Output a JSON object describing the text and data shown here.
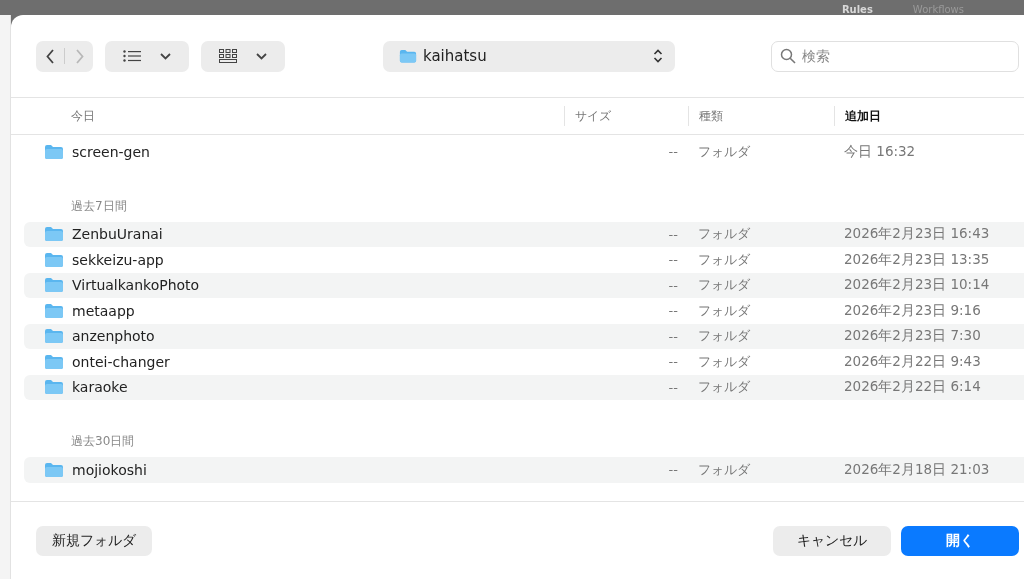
{
  "background_tabs": [
    {
      "label": "Rules",
      "selected": true
    },
    {
      "label": "Workflows",
      "selected": false
    }
  ],
  "toolbar": {
    "back_disabled": false,
    "forward_disabled": true,
    "location": "kaihatsu",
    "search": {
      "placeholder": "検索"
    }
  },
  "table": {
    "columns": [
      {
        "label": "今日",
        "sorted": false
      },
      {
        "label": "サイズ",
        "sorted": false
      },
      {
        "label": "種類",
        "sorted": false
      },
      {
        "label": "追加日",
        "sorted": true
      }
    ],
    "groups": [
      {
        "rows": [
          {
            "name": "screen-gen",
            "size": "--",
            "kind": "フォルダ",
            "date": "今日 16:32",
            "shaded": false
          }
        ]
      },
      {
        "title": "過去7日間",
        "rows": [
          {
            "name": "ZenbuUranai",
            "size": "--",
            "kind": "フォルダ",
            "date": "2026年2月23日 16:43",
            "shaded": true
          },
          {
            "name": "sekkeizu-app",
            "size": "--",
            "kind": "フォルダ",
            "date": "2026年2月23日 13:35",
            "shaded": false
          },
          {
            "name": "VirtualkankoPhoto",
            "size": "--",
            "kind": "フォルダ",
            "date": "2026年2月23日 10:14",
            "shaded": true
          },
          {
            "name": "metaapp",
            "size": "--",
            "kind": "フォルダ",
            "date": "2026年2月23日 9:16",
            "shaded": false
          },
          {
            "name": "anzenphoto",
            "size": "--",
            "kind": "フォルダ",
            "date": "2026年2月23日 7:30",
            "shaded": true
          },
          {
            "name": "ontei-changer",
            "size": "--",
            "kind": "フォルダ",
            "date": "2026年2月22日 9:43",
            "shaded": false
          },
          {
            "name": "karaoke",
            "size": "--",
            "kind": "フォルダ",
            "date": "2026年2月22日 6:14",
            "shaded": true
          }
        ]
      },
      {
        "title": "過去30日間",
        "rows": [
          {
            "name": "mojiokoshi",
            "size": "--",
            "kind": "フォルダ",
            "date": "2026年2月18日 21:03",
            "shaded": true
          }
        ]
      }
    ]
  },
  "footer": {
    "new_folder": "新規フォルダ",
    "cancel": "キャンセル",
    "open": "開く"
  }
}
